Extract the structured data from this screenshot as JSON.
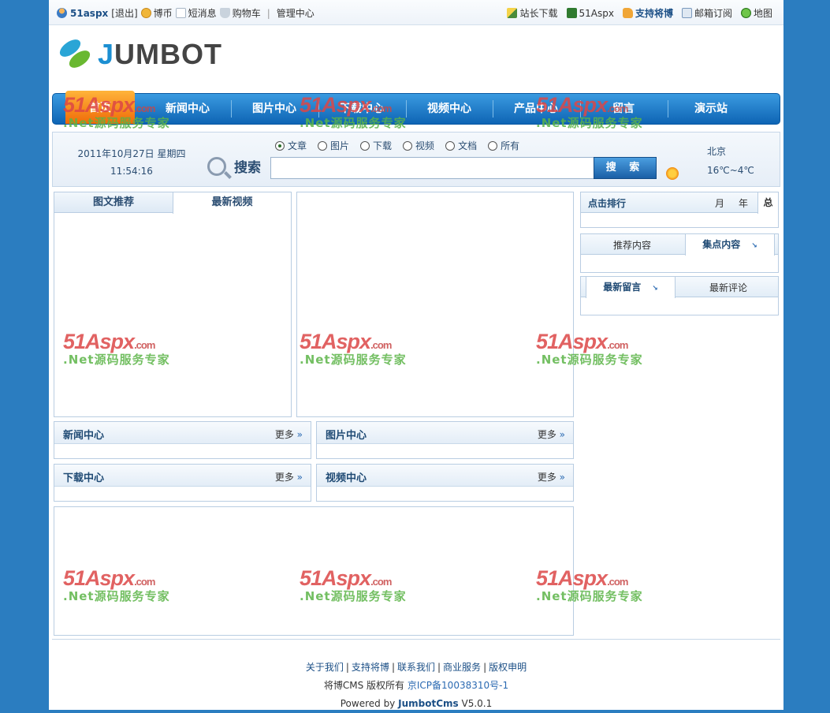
{
  "topbar": {
    "user": "51aspx",
    "logout": "[退出]",
    "coins": "博币",
    "messages": "短消息",
    "cart": "购物车",
    "admin": "管理中心",
    "right": [
      "站长下载",
      "51Aspx",
      "支持将博",
      "邮箱订阅",
      "地图"
    ]
  },
  "logo": {
    "first_letter": "J",
    "rest": "UMBOT"
  },
  "nav": [
    "首页",
    "新闻中心",
    "图片中心",
    "下载中心",
    "视频中心",
    "产品中心",
    "留言",
    "演示站"
  ],
  "search": {
    "date": "2011年10月27日 星期四",
    "time": "11:54:16",
    "radios": [
      "文章",
      "图片",
      "下载",
      "视频",
      "文档",
      "所有"
    ],
    "label": "搜索",
    "button": "搜 索",
    "input_value": ""
  },
  "weather": {
    "city": "北京",
    "temp": "16℃~4℃"
  },
  "left_tabs": [
    "图文推荐",
    "最新视频"
  ],
  "rank": {
    "title": "点击排行",
    "month": "月",
    "year": "年",
    "total": "总"
  },
  "side_tabs": {
    "recommend": "推荐内容",
    "focus": "集点内容",
    "msgs": "最新留言",
    "comments": "最新评论"
  },
  "sections": {
    "news": "新闻中心",
    "pics": "图片中心",
    "downloads": "下载中心",
    "videos": "视频中心",
    "more": "更多"
  },
  "watermark": {
    "line1": "51Aspx",
    "dotcom": ".com",
    "line2": ".Net源码服务专家"
  },
  "footer": {
    "links": [
      "关于我们",
      "支持将博",
      "联系我们",
      "商业服务",
      "版权申明"
    ],
    "copyright": "将博CMS  版权所有",
    "icp": "京ICP备10038310号-1",
    "powered": "Powered by",
    "product": "JumbotCms",
    "version": "V5.0.1"
  }
}
